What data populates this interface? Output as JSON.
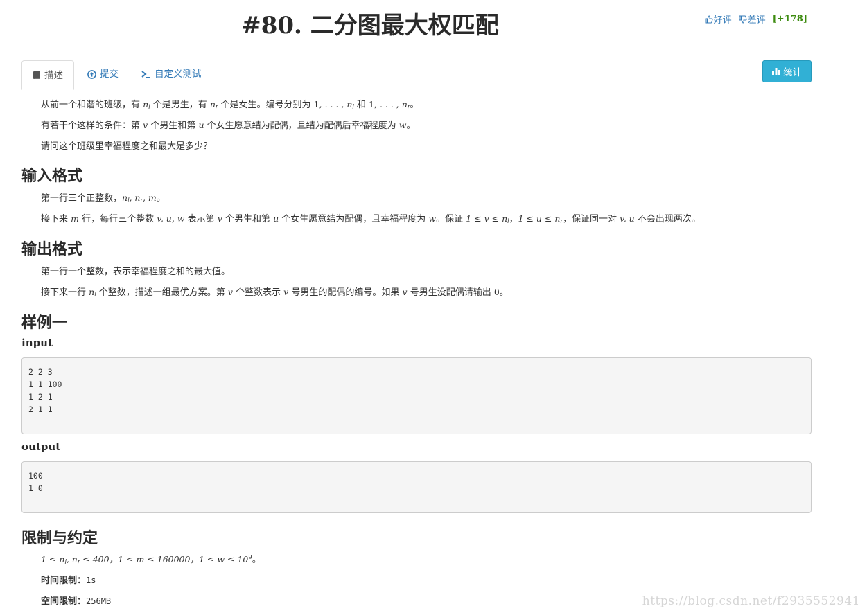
{
  "header": {
    "problem_number": "#80.",
    "problem_title": "二分图最大权匹配",
    "like_label": "好评",
    "dislike_label": "差评",
    "score": "[+178]"
  },
  "tabs": [
    {
      "label": "描述",
      "icon": "book-icon"
    },
    {
      "label": "提交",
      "icon": "upload-icon"
    },
    {
      "label": "自定义测试",
      "icon": "terminal-icon"
    }
  ],
  "stats_button": {
    "label": "统计",
    "icon": "bar-chart-icon"
  },
  "description": {
    "p1": {
      "a": "从前一个和谐的班级，有 ",
      "v1": "n",
      "s1": "l",
      "b": " 个是男生，有 ",
      "v2": "n",
      "s2": "r",
      "c": " 个是女生。编号分别为 ",
      "r1": "1, . . . , ",
      "v3": "n",
      "s3": "l",
      "d": " 和 ",
      "r2": "1, . . . , ",
      "v4": "n",
      "s4": "r",
      "e": "。"
    },
    "p2": {
      "a": "有若干个这样的条件：第 ",
      "v1": "v",
      "b": " 个男生和第 ",
      "v2": "u",
      "c": " 个女生愿意结为配偶，且结为配偶后幸福程度为 ",
      "v3": "w",
      "d": "。"
    },
    "p3": "请问这个班级里幸福程度之和最大是多少？"
  },
  "input_format": {
    "heading": "输入格式",
    "l1": {
      "a": "第一行三个正整数，",
      "m": "n",
      "s1": "l",
      "c": ", n",
      "s2": "r",
      "d": ", m",
      "e": "。"
    },
    "l2": {
      "a": "接下来 ",
      "v1": "m",
      "b": " 行，每行三个整数 ",
      "v2": "v, u, w",
      "c": " 表示第 ",
      "v3": "v",
      "d": " 个男生和第 ",
      "v4": "u",
      "e": " 个女生愿意结为配偶，且幸福程度为 ",
      "v5": "w",
      "f": "。保证 ",
      "r1": "1 ≤ v ≤ n",
      "s1": "l",
      "g": "，",
      "r2": "1 ≤ u ≤ n",
      "s2": "r",
      "h": "，保证同一对 ",
      "v6": "v, u",
      "i": " 不会出现两次。"
    }
  },
  "output_format": {
    "heading": "输出格式",
    "l1": "第一行一个整数，表示幸福程度之和的最大值。",
    "l2": {
      "a": "接下来一行 ",
      "v1": "n",
      "s1": "l",
      "b": " 个整数，描述一组最优方案。第 ",
      "v2": "v",
      "c": " 个整数表示 ",
      "v3": "v",
      "d": " 号男生的配偶的编号。如果 ",
      "v4": "v",
      "e": " 号男生没配偶请输出 ",
      "n": "0",
      "f": "。"
    }
  },
  "sample": {
    "heading": "样例一",
    "input_label": "input",
    "input": "2 2 3\n1 1 100\n1 2 1\n2 1 1",
    "output_label": "output",
    "output": "100\n1 0"
  },
  "limits": {
    "heading": "限制与约定",
    "l1": {
      "a": "1 ≤ n",
      "s1": "l",
      "b": ", n",
      "s2": "r",
      "c": " ≤ 400，1 ≤ m ≤ 160000，1 ≤ w ≤ 10",
      "sup": "9",
      "d": "。"
    },
    "time_label": "时间限制：",
    "time_value": "1s",
    "space_label": "空间限制：",
    "space_value": "256MB"
  },
  "watermark": "https://blog.csdn.net/f2935552941"
}
